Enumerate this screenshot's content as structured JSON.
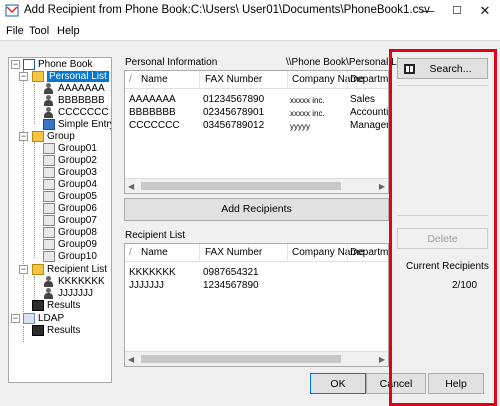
{
  "window": {
    "title": "Add Recipient from Phone Book:C:\\Users\\ User01\\Documents\\PhoneBook1.csv",
    "minimize": "—",
    "maximize": "☐",
    "close": "✕"
  },
  "menu": {
    "items": [
      "File",
      "Tool",
      "Help"
    ]
  },
  "tree": {
    "root": "Phone Book",
    "personal_list": "Personal List",
    "entries": [
      "AAAAAAA",
      "BBBBBBB",
      "CCCCCCC"
    ],
    "simple_entry": "Simple Entry",
    "group": "Group",
    "groups": [
      "Group01",
      "Group02",
      "Group03",
      "Group04",
      "Group05",
      "Group06",
      "Group07",
      "Group08",
      "Group09",
      "Group10"
    ],
    "recipient_list": "Recipient List",
    "recipients": [
      "KKKKKKK",
      "JJJJJJJ"
    ],
    "results": "Results",
    "ldap": "LDAP",
    "ldap_results": "Results"
  },
  "personal_info": {
    "label": "Personal Information",
    "path": "\\\\Phone Book\\Personal List",
    "columns": [
      "Name",
      "FAX Number",
      "Company Name",
      "Departmen"
    ],
    "rows": [
      [
        "AAAAAAA",
        "01234567890",
        "xxxxx inc.",
        "Sales"
      ],
      [
        "BBBBBBB",
        "02345678901",
        "xxxxx inc.",
        "Accounting"
      ],
      [
        "CCCCCCC",
        "03456789012",
        "yyyyy",
        "Manageme"
      ]
    ]
  },
  "add_recipients_button": "Add Recipients",
  "recipient_list": {
    "label": "Recipient List",
    "columns": [
      "Name",
      "FAX Number",
      "Company Name",
      "Departmen"
    ],
    "rows": [
      [
        "KKKKKKK",
        "0987654321",
        "",
        ""
      ],
      [
        "JJJJJJJ",
        "1234567890",
        "",
        ""
      ]
    ]
  },
  "right_panel": {
    "search_button": "Search...",
    "delete_button": "Delete",
    "current_recipients_label": "Current Recipients",
    "count": "2/100"
  },
  "footer": {
    "ok": "OK",
    "cancel": "Cancel",
    "help": "Help"
  },
  "colors": {
    "highlight": "#e3001b",
    "selection": "#0078d7"
  }
}
